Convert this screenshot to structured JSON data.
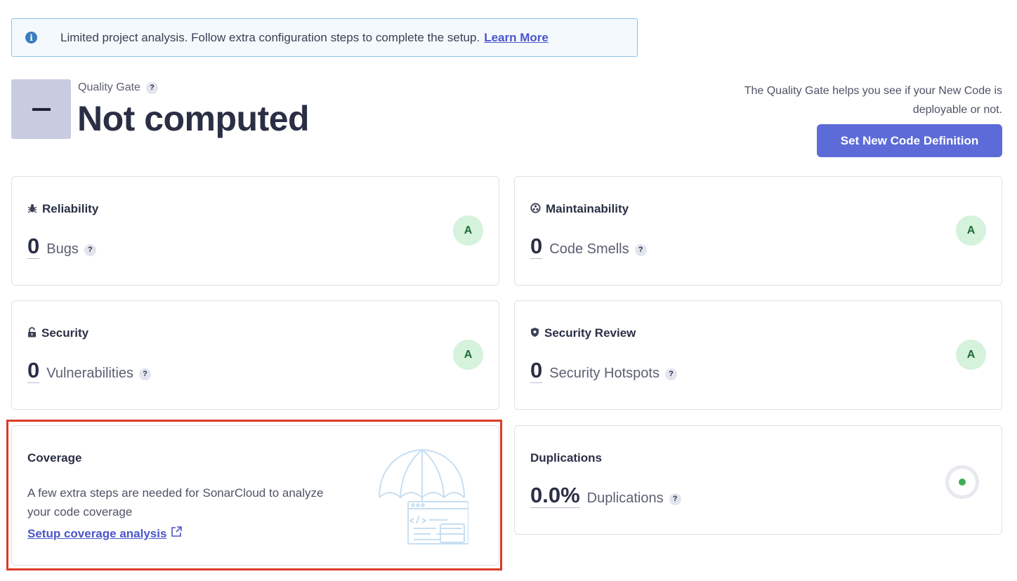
{
  "banner": {
    "message": "Limited project analysis. Follow extra configuration steps to complete the setup.",
    "link": "Learn More",
    "icon": "info-icon"
  },
  "quality_gate": {
    "label": "Quality Gate",
    "help": "?",
    "status": "Not computed",
    "description": "The Quality Gate helps you see if your New Code is deployable or not.",
    "button": "Set New Code Definition"
  },
  "cards": {
    "reliability": {
      "title": "Reliability",
      "icon": "bug-icon",
      "value": "0",
      "metric": "Bugs",
      "rating": "A"
    },
    "maintainability": {
      "title": "Maintainability",
      "icon": "maintainability-icon",
      "value": "0",
      "metric": "Code Smells",
      "rating": "A"
    },
    "security": {
      "title": "Security",
      "icon": "lock-icon",
      "value": "0",
      "metric": "Vulnerabilities",
      "rating": "A"
    },
    "security_review": {
      "title": "Security Review",
      "icon": "shield-icon",
      "value": "0",
      "metric": "Security Hotspots",
      "rating": "A"
    },
    "coverage": {
      "title": "Coverage",
      "text": "A few extra steps are needed for SonarCloud to analyze your code coverage",
      "link": "Setup coverage analysis",
      "icon": "umbrella-illustration"
    },
    "duplications": {
      "title": "Duplications",
      "value": "0.0%",
      "metric": "Duplications",
      "icon": "duplications-ring-icon"
    }
  },
  "colors": {
    "accent": "#5d6bd8",
    "rating_bg": "#d5f2dc",
    "highlight": "#dc3b26"
  }
}
